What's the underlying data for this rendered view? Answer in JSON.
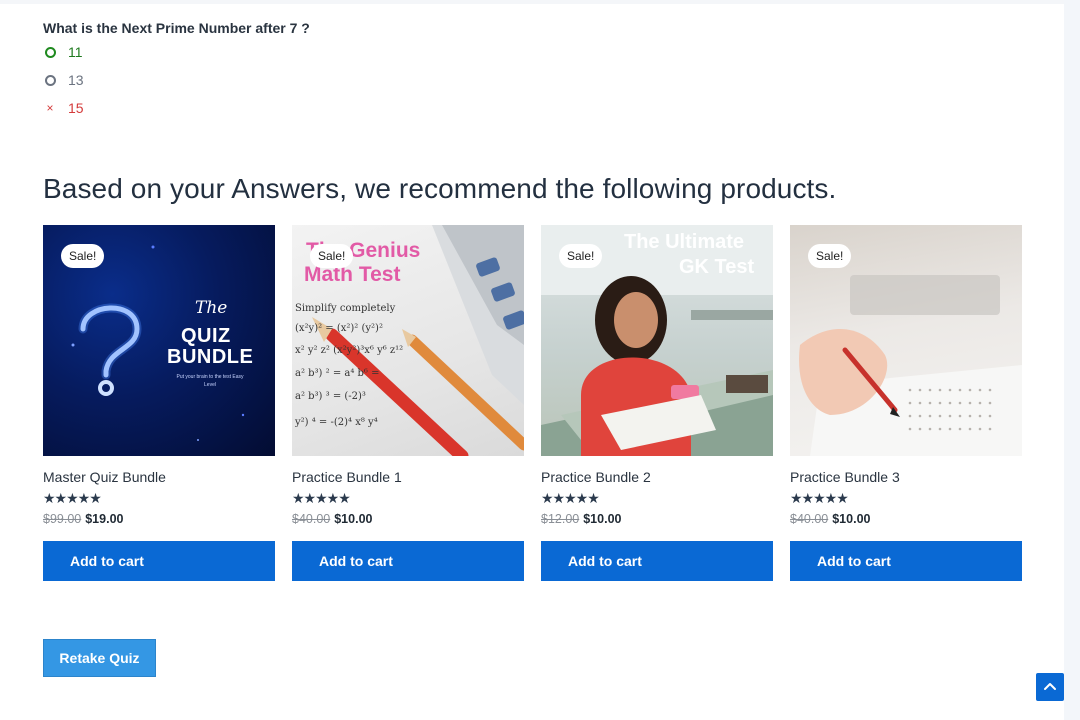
{
  "quiz": {
    "question": "What is the Next Prime Number after 7 ?",
    "answers": [
      {
        "label": "11",
        "state": "correct"
      },
      {
        "label": "13",
        "state": "neutral"
      },
      {
        "label": "15",
        "state": "wrong"
      }
    ],
    "wrong_mark": "×"
  },
  "recommendations": {
    "heading": "Based on your Answers, we recommend the following products.",
    "products": [
      {
        "name": "Master Quiz Bundle",
        "badge": "Sale!",
        "stars": "★★★★★",
        "rating": 5,
        "old_price": "$99.00",
        "new_price": "$19.00",
        "button": "Add to cart",
        "image_text": {
          "the": "The",
          "quiz": "QUIZ",
          "bundle": "BUNDLE",
          "tagline": "Put your brain to the test Easy Level"
        }
      },
      {
        "name": "Practice Bundle 1",
        "badge": "Sale!",
        "stars": "★★★★★",
        "rating": 5,
        "old_price": "$40.00",
        "new_price": "$10.00",
        "button": "Add to cart",
        "image_text": {
          "line1": "The Genius",
          "line2": "Math Test"
        }
      },
      {
        "name": "Practice Bundle 2",
        "badge": "Sale!",
        "stars": "★★★★★",
        "rating": 5,
        "old_price": "$12.00",
        "new_price": "$10.00",
        "button": "Add to cart",
        "image_text": {
          "line1": "The Ultimate",
          "line2": "GK Test"
        }
      },
      {
        "name": "Practice Bundle 3",
        "badge": "Sale!",
        "stars": "★★★★★",
        "rating": 5,
        "old_price": "$40.00",
        "new_price": "$10.00",
        "button": "Add to cart"
      }
    ]
  },
  "retake_button": "Retake Quiz",
  "colors": {
    "primary_button": "#0a69d4",
    "retake_button": "#3497e4",
    "correct": "#1f8a1f",
    "wrong": "#d43b3b"
  },
  "icons": {
    "scroll_top": "chevron-up-icon",
    "correct_marker": "radio-ring-icon",
    "wrong_marker": "cross-icon",
    "rating": "star-icon"
  }
}
